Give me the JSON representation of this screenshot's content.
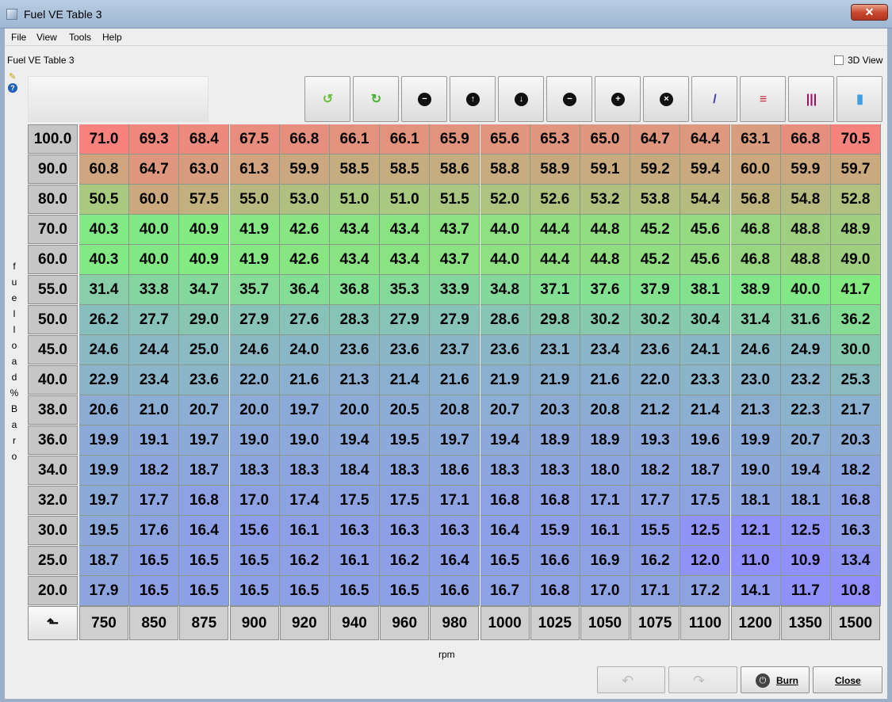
{
  "window": {
    "title": "Fuel VE Table 3"
  },
  "menu": [
    "File",
    "View",
    "Tools",
    "Help"
  ],
  "panel_title": "Fuel VE Table 3",
  "view3d_label": "3D View",
  "y_axis_label": "fuel load % Baro",
  "x_axis_label": "rpm",
  "toolbar_icons": [
    {
      "name": "undo-green-icon",
      "glyph": "↺",
      "color": "#6bbf3a"
    },
    {
      "name": "redo-green-icon",
      "glyph": "↻",
      "color": "#48b030"
    },
    {
      "name": "minus-circle-icon",
      "glyph": "−",
      "color": "#000000"
    },
    {
      "name": "arrow-up-icon",
      "glyph": "↑",
      "color": "#000000"
    },
    {
      "name": "arrow-down-icon",
      "glyph": "↓",
      "color": "#000000"
    },
    {
      "name": "decrement-icon",
      "glyph": "−",
      "color": "#000000"
    },
    {
      "name": "increment-icon",
      "glyph": "+",
      "color": "#000000"
    },
    {
      "name": "cancel-icon",
      "glyph": "×",
      "color": "#000000"
    },
    {
      "name": "interpolate-pen-icon",
      "glyph": "/",
      "color": "#3a3ab0"
    },
    {
      "name": "horizontal-smooth-icon",
      "glyph": "≡",
      "color": "#c0203a"
    },
    {
      "name": "vertical-smooth-icon",
      "glyph": "|||",
      "color": "#a01060"
    },
    {
      "name": "color-gradient-icon",
      "glyph": "▮",
      "color": "#3fa0e0"
    }
  ],
  "rows": [
    "100.0",
    "90.0",
    "80.0",
    "70.0",
    "60.0",
    "55.0",
    "50.0",
    "45.0",
    "40.0",
    "38.0",
    "36.0",
    "34.0",
    "32.0",
    "30.0",
    "25.0",
    "20.0"
  ],
  "cols": [
    "750",
    "850",
    "875",
    "900",
    "920",
    "940",
    "960",
    "980",
    "1000",
    "1025",
    "1050",
    "1075",
    "1100",
    "1200",
    "1350",
    "1500"
  ],
  "table": [
    [
      "71.0",
      "69.3",
      "68.4",
      "67.5",
      "66.8",
      "66.1",
      "66.1",
      "65.9",
      "65.6",
      "65.3",
      "65.0",
      "64.7",
      "64.4",
      "63.1",
      "66.8",
      "70.5"
    ],
    [
      "60.8",
      "64.7",
      "63.0",
      "61.3",
      "59.9",
      "58.5",
      "58.5",
      "58.6",
      "58.8",
      "58.9",
      "59.1",
      "59.2",
      "59.4",
      "60.0",
      "59.9",
      "59.7"
    ],
    [
      "50.5",
      "60.0",
      "57.5",
      "55.0",
      "53.0",
      "51.0",
      "51.0",
      "51.5",
      "52.0",
      "52.6",
      "53.2",
      "53.8",
      "54.4",
      "56.8",
      "54.8",
      "52.8"
    ],
    [
      "40.3",
      "40.0",
      "40.9",
      "41.9",
      "42.6",
      "43.4",
      "43.4",
      "43.7",
      "44.0",
      "44.4",
      "44.8",
      "45.2",
      "45.6",
      "46.8",
      "48.8",
      "48.9"
    ],
    [
      "40.3",
      "40.0",
      "40.9",
      "41.9",
      "42.6",
      "43.4",
      "43.4",
      "43.7",
      "44.0",
      "44.4",
      "44.8",
      "45.2",
      "45.6",
      "46.8",
      "48.8",
      "49.0"
    ],
    [
      "31.4",
      "33.8",
      "34.7",
      "35.7",
      "36.4",
      "36.8",
      "35.3",
      "33.9",
      "34.8",
      "37.1",
      "37.6",
      "37.9",
      "38.1",
      "38.9",
      "40.0",
      "41.7"
    ],
    [
      "26.2",
      "27.7",
      "29.0",
      "27.9",
      "27.6",
      "28.3",
      "27.9",
      "27.9",
      "28.6",
      "29.8",
      "30.2",
      "30.2",
      "30.4",
      "31.4",
      "31.6",
      "36.2"
    ],
    [
      "24.6",
      "24.4",
      "25.0",
      "24.6",
      "24.0",
      "23.6",
      "23.6",
      "23.7",
      "23.6",
      "23.1",
      "23.4",
      "23.6",
      "24.1",
      "24.6",
      "24.9",
      "30.0"
    ],
    [
      "22.9",
      "23.4",
      "23.6",
      "22.0",
      "21.6",
      "21.3",
      "21.4",
      "21.6",
      "21.9",
      "21.9",
      "21.6",
      "22.0",
      "23.3",
      "23.0",
      "23.2",
      "25.3"
    ],
    [
      "20.6",
      "21.0",
      "20.7",
      "20.0",
      "19.7",
      "20.0",
      "20.5",
      "20.8",
      "20.7",
      "20.3",
      "20.8",
      "21.2",
      "21.4",
      "21.3",
      "22.3",
      "21.7"
    ],
    [
      "19.9",
      "19.1",
      "19.7",
      "19.0",
      "19.0",
      "19.4",
      "19.5",
      "19.7",
      "19.4",
      "18.9",
      "18.9",
      "19.3",
      "19.6",
      "19.9",
      "20.7",
      "20.3"
    ],
    [
      "19.9",
      "18.2",
      "18.7",
      "18.3",
      "18.3",
      "18.4",
      "18.3",
      "18.6",
      "18.3",
      "18.3",
      "18.0",
      "18.2",
      "18.7",
      "19.0",
      "19.4",
      "18.2"
    ],
    [
      "19.7",
      "17.7",
      "16.8",
      "17.0",
      "17.4",
      "17.5",
      "17.5",
      "17.1",
      "16.8",
      "16.8",
      "17.1",
      "17.7",
      "17.5",
      "18.1",
      "18.1",
      "16.8"
    ],
    [
      "19.5",
      "17.6",
      "16.4",
      "15.6",
      "16.1",
      "16.3",
      "16.3",
      "16.3",
      "16.4",
      "15.9",
      "16.1",
      "15.5",
      "12.5",
      "12.1",
      "12.5",
      "16.3"
    ],
    [
      "18.7",
      "16.5",
      "16.5",
      "16.5",
      "16.2",
      "16.1",
      "16.2",
      "16.4",
      "16.5",
      "16.6",
      "16.9",
      "16.2",
      "12.0",
      "11.0",
      "10.9",
      "13.4"
    ],
    [
      "17.9",
      "16.5",
      "16.5",
      "16.5",
      "16.5",
      "16.5",
      "16.5",
      "16.6",
      "16.7",
      "16.8",
      "17.0",
      "17.1",
      "17.2",
      "14.1",
      "11.7",
      "10.8"
    ]
  ],
  "buttons": {
    "burn": "Burn",
    "close": "Close"
  }
}
